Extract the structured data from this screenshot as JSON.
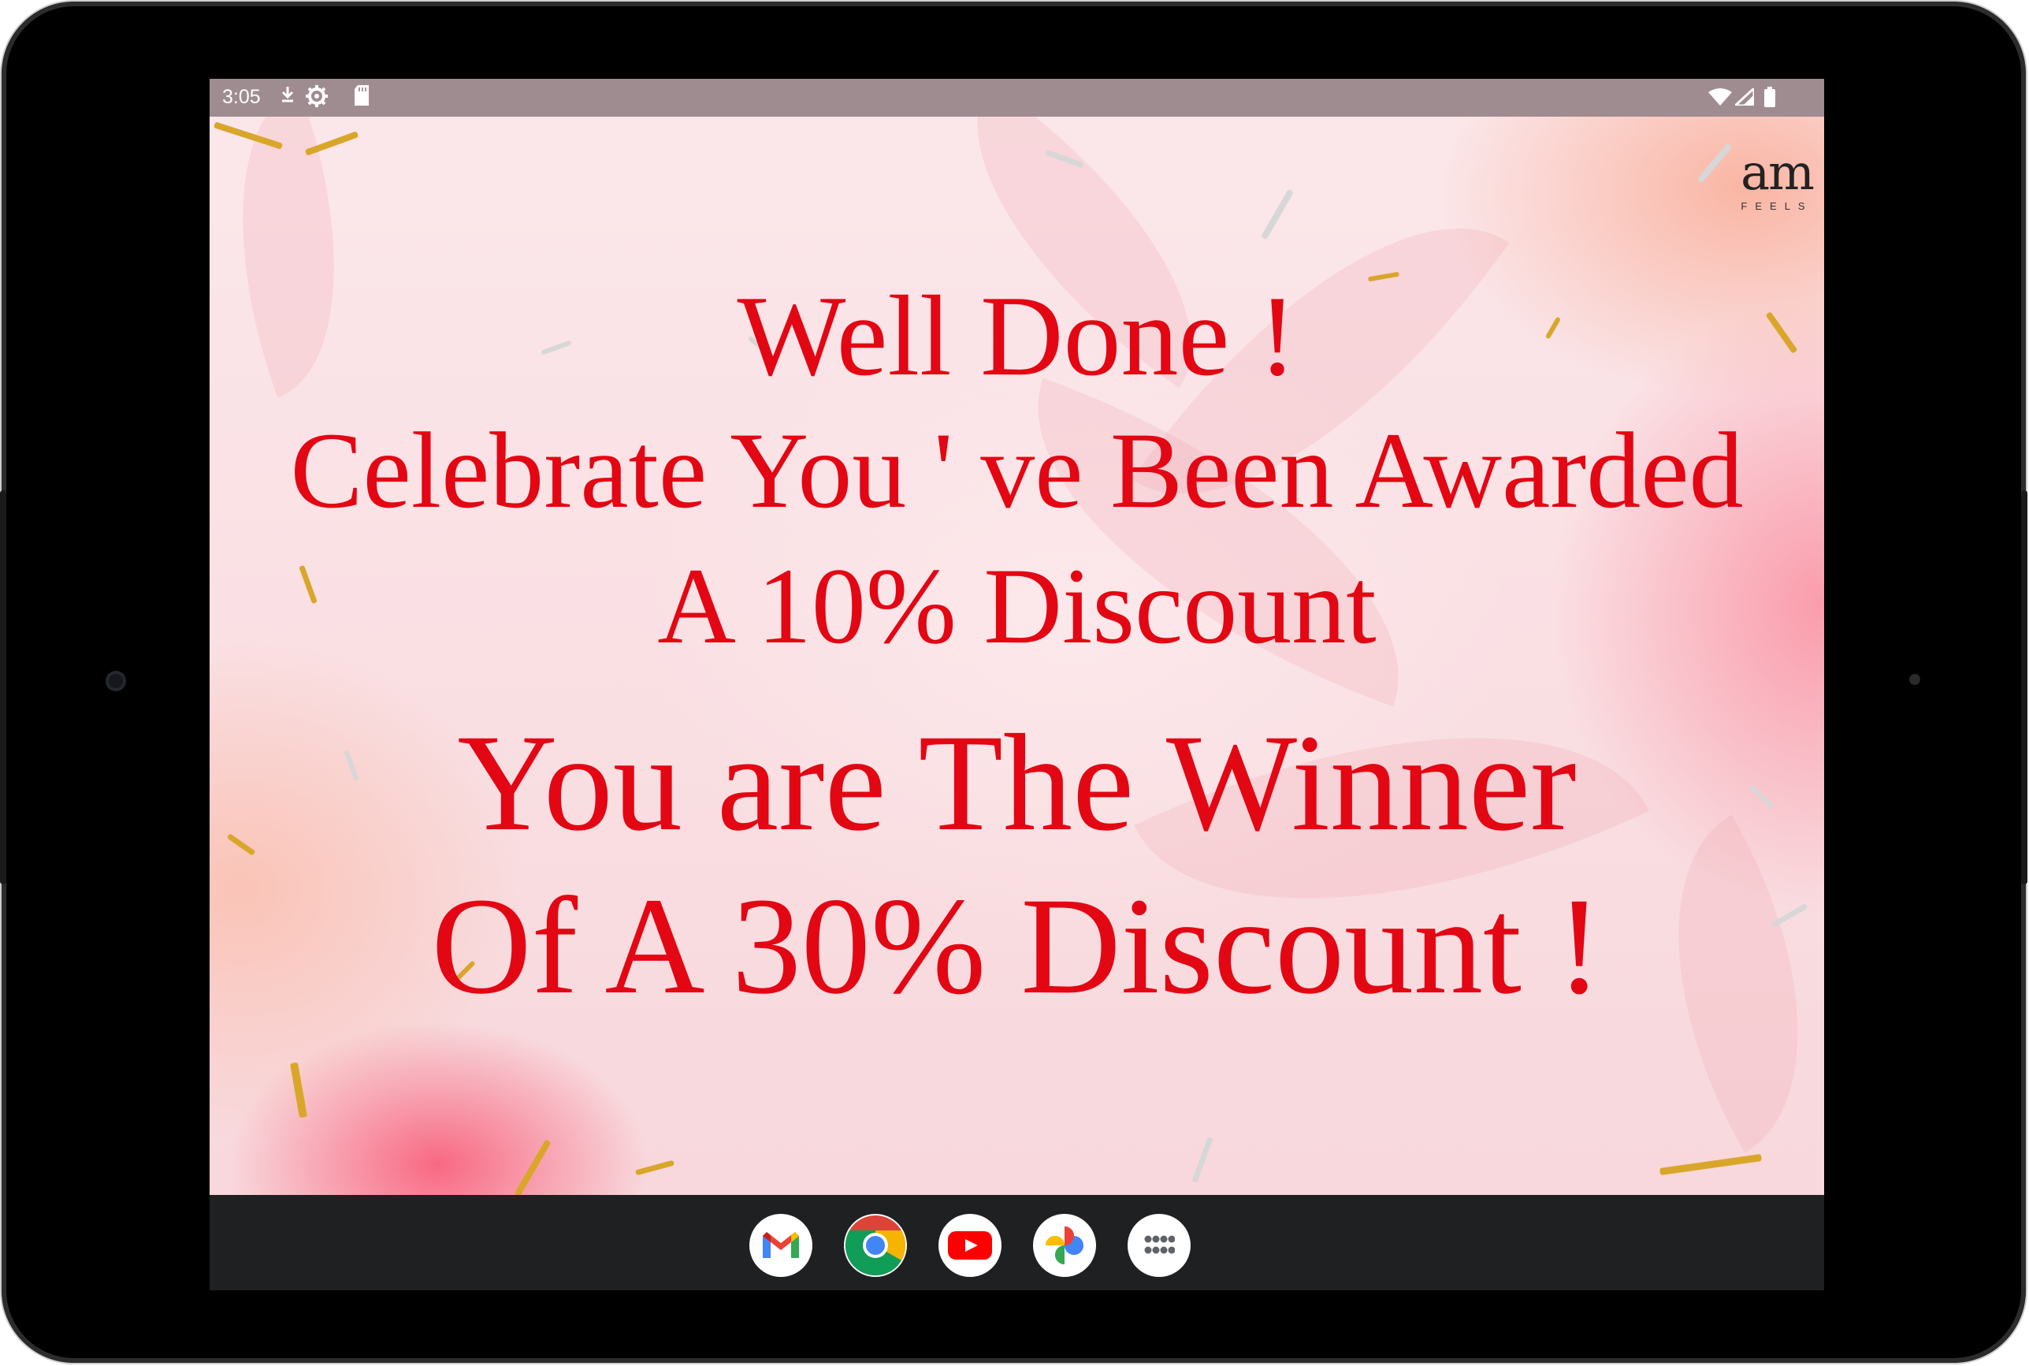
{
  "status_bar": {
    "time": "3:05",
    "left_icons": [
      "download-icon",
      "settings-icon",
      "sd-card-icon"
    ],
    "right_icons": [
      "wifi-icon",
      "cell-signal-icon",
      "battery-icon"
    ]
  },
  "brand": {
    "logo_main": "am",
    "logo_sub": "FEELS"
  },
  "message": {
    "line1": "Well Done !",
    "line2": "Celebrate You ' ve Been Awarded",
    "line3": "A 10% Discount",
    "line4": "You are The Winner",
    "line5": "Of A 30% Discount !"
  },
  "colors": {
    "text_accent": "#e30613",
    "background_pink": "#fbe7ea",
    "confetti_gold": "#d9a62a",
    "confetti_silver": "#d7d7d7"
  },
  "dock": {
    "apps": [
      "gmail-icon",
      "chrome-icon",
      "youtube-icon",
      "photos-icon",
      "app-drawer-icon"
    ]
  }
}
